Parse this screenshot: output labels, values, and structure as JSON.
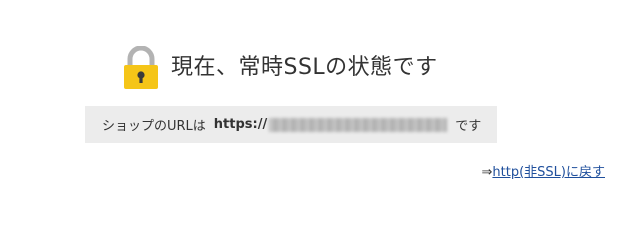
{
  "status": {
    "title": "現在、常時SSLの状態です",
    "lock_icon": "lock-icon",
    "lock_color": "#f5c518"
  },
  "url_box": {
    "prefix_label": "ショップのURLは",
    "url_scheme": "https://",
    "url_host_blurred": true,
    "suffix_label": "です"
  },
  "footer": {
    "arrow": "⇒",
    "back_link_label": "http(非SSL)に戻す"
  }
}
